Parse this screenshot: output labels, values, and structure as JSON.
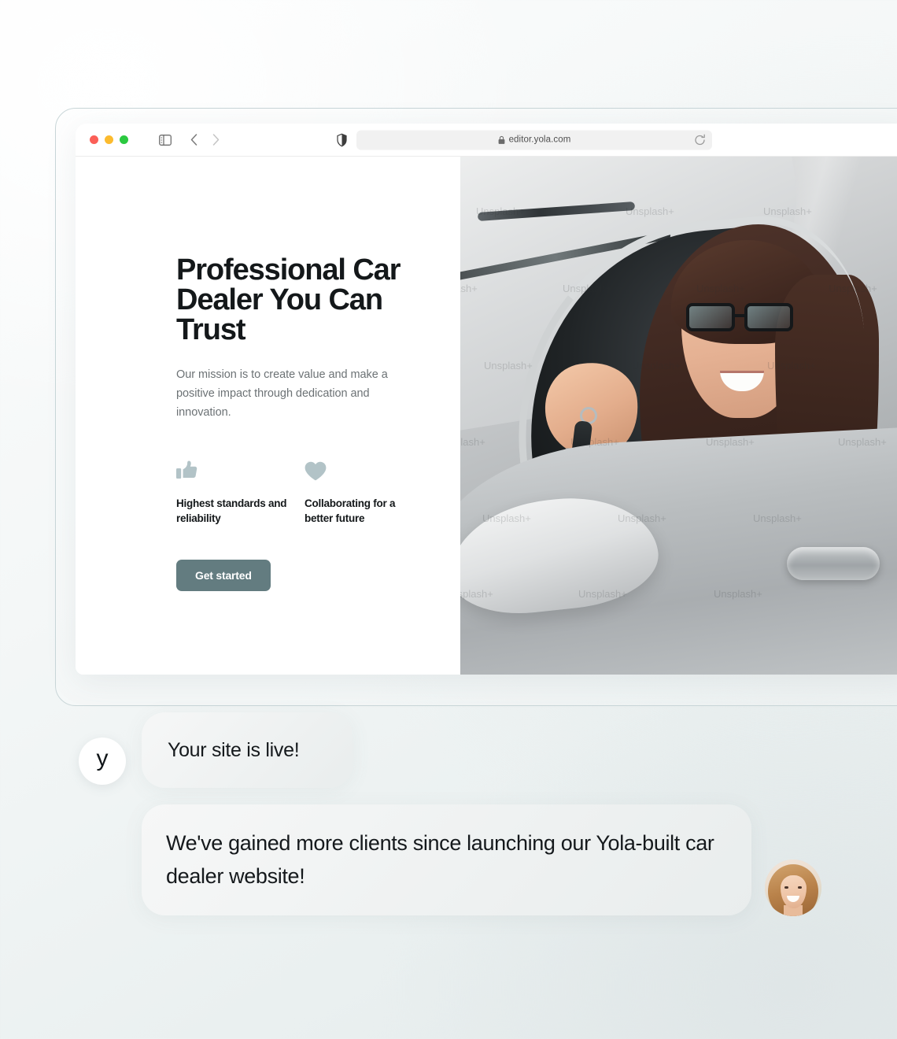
{
  "browser": {
    "traffic_lights": [
      "close",
      "minimize",
      "maximize"
    ],
    "sidebar_icon": "sidebar-toggle-icon",
    "back_icon": "chevron-left-icon",
    "forward_icon": "chevron-right-icon",
    "shield_icon": "shield-privacy-icon",
    "lock_icon": "lock-icon",
    "url": "editor.yola.com",
    "reload_icon": "reload-icon"
  },
  "hero": {
    "headline": "Professional Car Dealer You Can Trust",
    "subtext": "Our mission is to create value and make a positive impact through dedication and innovation.",
    "features": [
      {
        "icon": "thumbs-up-icon",
        "label": "Highest standards and reliability"
      },
      {
        "icon": "heart-icon",
        "label": "Collaborating for a better future"
      }
    ],
    "cta_label": "Get started",
    "image_alt": "Woman in white car holding car keys",
    "image_watermark": "Unsplash+"
  },
  "chat": {
    "logo_letter": "y",
    "messages": [
      {
        "text": "Your site is live!",
        "variant": "short"
      },
      {
        "text": "We've gained more clients since launching our Yola-built car dealer website!",
        "variant": "long"
      }
    ],
    "avatar_alt": "Smiling woman portrait"
  },
  "colors": {
    "accent_button": "#637c80",
    "feature_icon": "#b2c3c7",
    "heading_text": "#14181a",
    "body_text": "#6c7275",
    "bubble_bg": "#eef1f1"
  }
}
